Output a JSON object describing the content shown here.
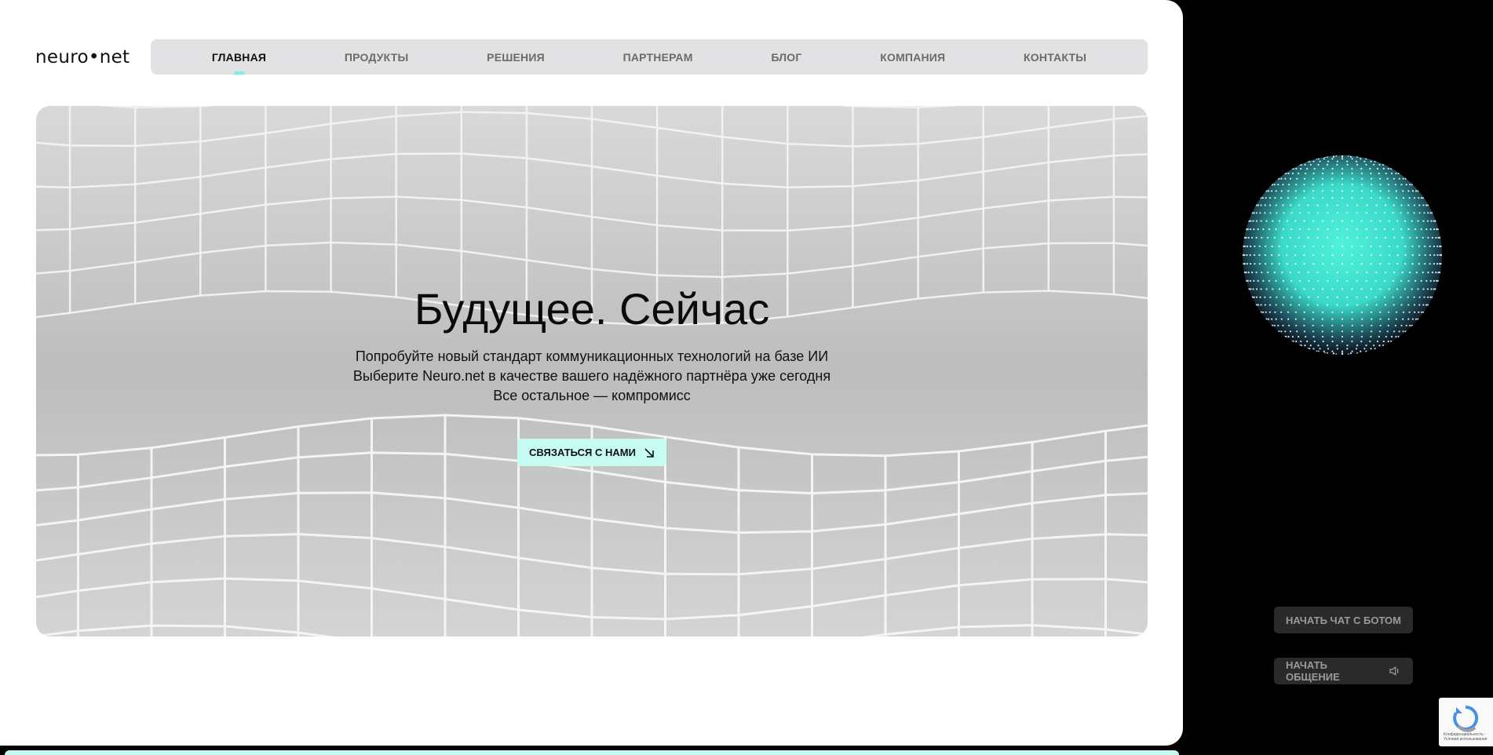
{
  "brand": {
    "logo": "neuro•net"
  },
  "nav": {
    "items": [
      {
        "label": "ГЛАВНАЯ",
        "active": true
      },
      {
        "label": "ПРОДУКТЫ",
        "active": false
      },
      {
        "label": "РЕШЕНИЯ",
        "active": false
      },
      {
        "label": "ПАРТНЕРАМ",
        "active": false
      },
      {
        "label": "БЛОГ",
        "active": false
      },
      {
        "label": "КОМПАНИЯ",
        "active": false
      },
      {
        "label": "КОНТАКТЫ",
        "active": false
      }
    ]
  },
  "hero": {
    "title": "Будущее. Сейчас",
    "lines": [
      "Попробуйте новый стандарт коммуникационных технологий на базе ИИ",
      "Выберите Neuro.net в качестве вашего надёжного партнёра уже сегодня",
      "Все остальное — компромисс"
    ],
    "cta_label": "СВЯЗАТЬСЯ С НАМИ"
  },
  "side": {
    "chat_button": "НАЧАТЬ ЧАТ С БОТОМ",
    "talk_button": "НАЧАТЬ ОБЩЕНИЕ"
  },
  "recaptcha": {
    "text": "Конфиденциальность - Условия использования"
  },
  "colors": {
    "accent": "#c6fbf3",
    "nav_bg": "#e2e2e4",
    "sphere_glow": "#4ff2dc",
    "page_bg": "#000000"
  },
  "icons": {
    "cta": "arrow-down-right-icon",
    "talk": "voice-icon"
  }
}
